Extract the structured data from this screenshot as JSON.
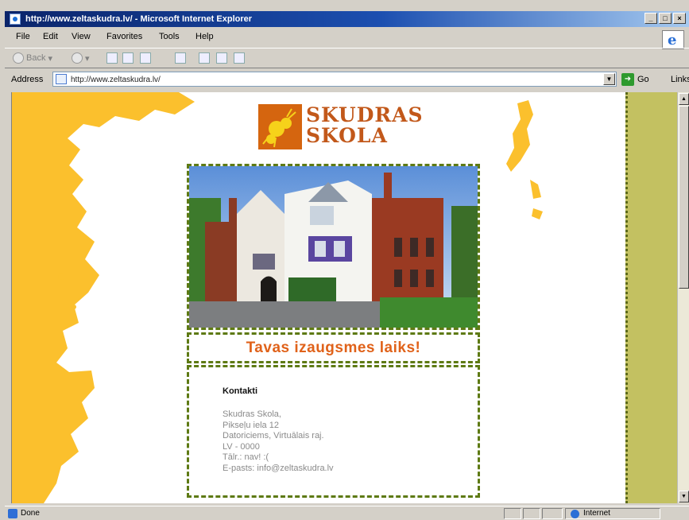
{
  "window": {
    "title": "http://www.zeltaskudra.lv/ - Microsoft Internet Explorer",
    "controls": [
      "_",
      "□",
      "×"
    ]
  },
  "menu": [
    "File",
    "Edit",
    "View",
    "Favorites",
    "Tools",
    "Help"
  ],
  "toolbar": {
    "back_label": "Back"
  },
  "address": {
    "label": "Address",
    "url": "http://www.zeltaskudra.lv/",
    "go_label": "Go",
    "links_label": "Links"
  },
  "page": {
    "logo_line1": "SKUDRAS",
    "logo_line2": "SKOLA",
    "slogan": "Tavas izaugsmes laiks!",
    "contact": {
      "heading": "Kontakti",
      "lines": [
        "Skudras Skola,",
        "Pikseļu iela 12",
        "Datoriciems, Virtuālais raj.",
        "LV - 0000",
        "Tālr.: nav! :(",
        "E-pasts: info@zeltaskudra.lv"
      ]
    }
  },
  "status": {
    "text": "Done",
    "zone": "Internet"
  },
  "colors": {
    "map_yellow": "#fbc02d",
    "brand_orange": "#e0621a",
    "dash_green": "#5e7a14",
    "panel_olive": "#c3c161"
  }
}
